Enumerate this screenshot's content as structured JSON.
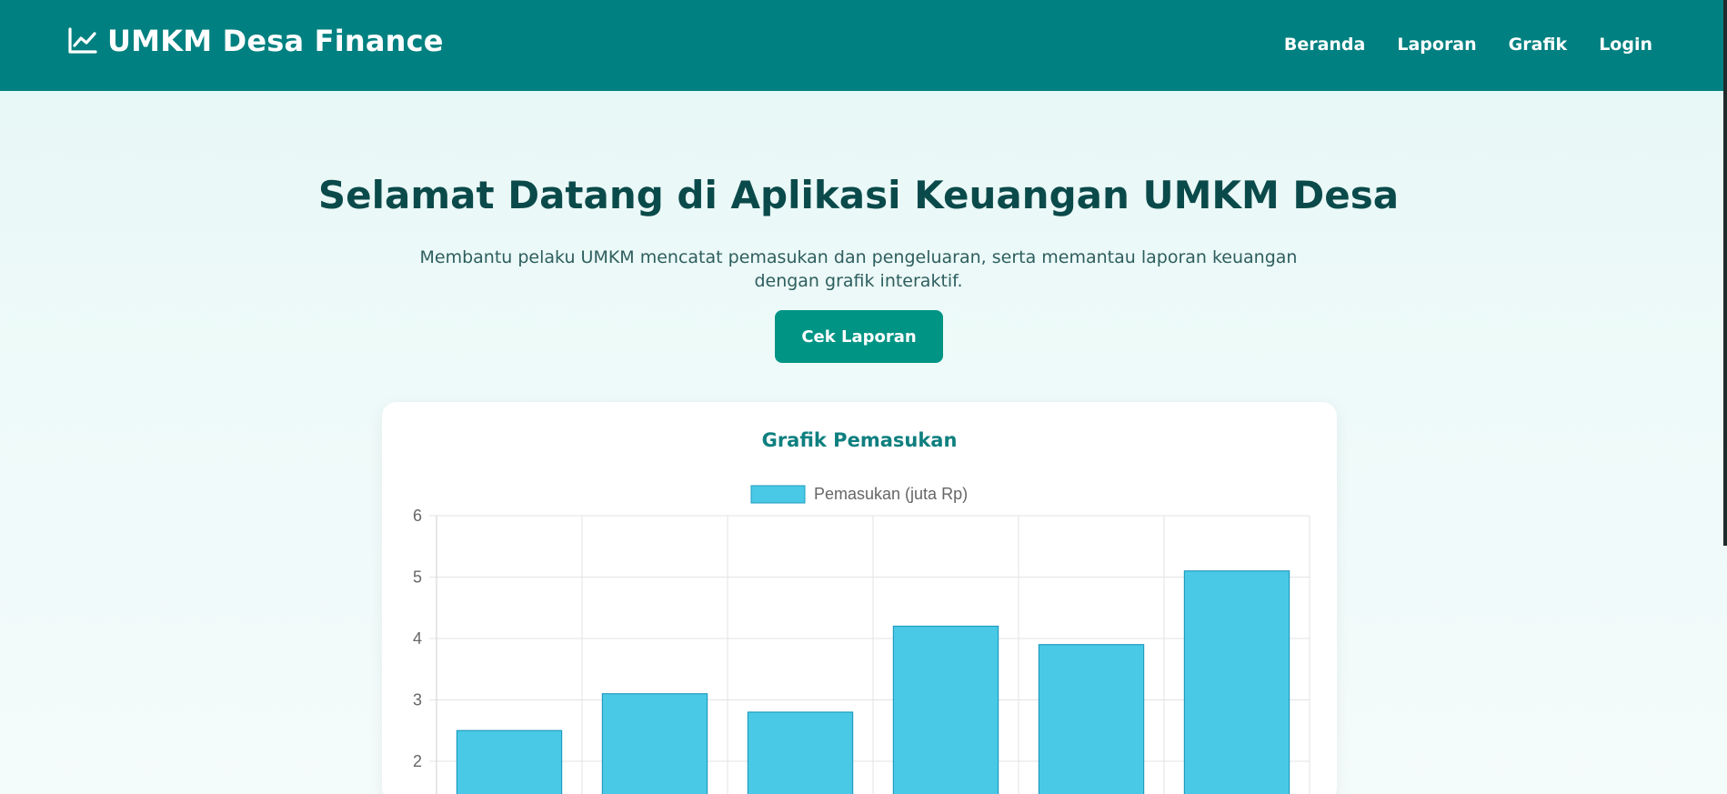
{
  "header": {
    "brand": "UMKM Desa Finance",
    "brand_icon": "line-chart-icon",
    "nav": [
      "Beranda",
      "Laporan",
      "Grafik",
      "Login"
    ]
  },
  "hero": {
    "title": "Selamat Datang di Aplikasi Keuangan UMKM Desa",
    "subtitle": "Membantu pelaku UMKM mencatat pemasukan dan pengeluaran, serta memantau laporan keuangan dengan grafik interaktif.",
    "cta": "Cek Laporan"
  },
  "colors": {
    "header": "#008080",
    "accent": "#009485",
    "bar_fill": "#49c9e5",
    "bar_stroke": "#1f9cc0"
  },
  "chart_card": {
    "title": "Grafik Pemasukan"
  },
  "chart_data": {
    "type": "bar",
    "values": [
      2.5,
      3.1,
      2.8,
      4.2,
      3.9,
      5.1
    ],
    "series": [
      {
        "name": "Pemasukan (juta Rp)",
        "values": [
          2.5,
          3.1,
          2.8,
          4.2,
          3.9,
          5.1
        ]
      }
    ],
    "yticks": [
      6,
      5,
      4,
      3,
      2
    ],
    "ylim": [
      0,
      6
    ],
    "grid": true,
    "legend": "top-center"
  }
}
